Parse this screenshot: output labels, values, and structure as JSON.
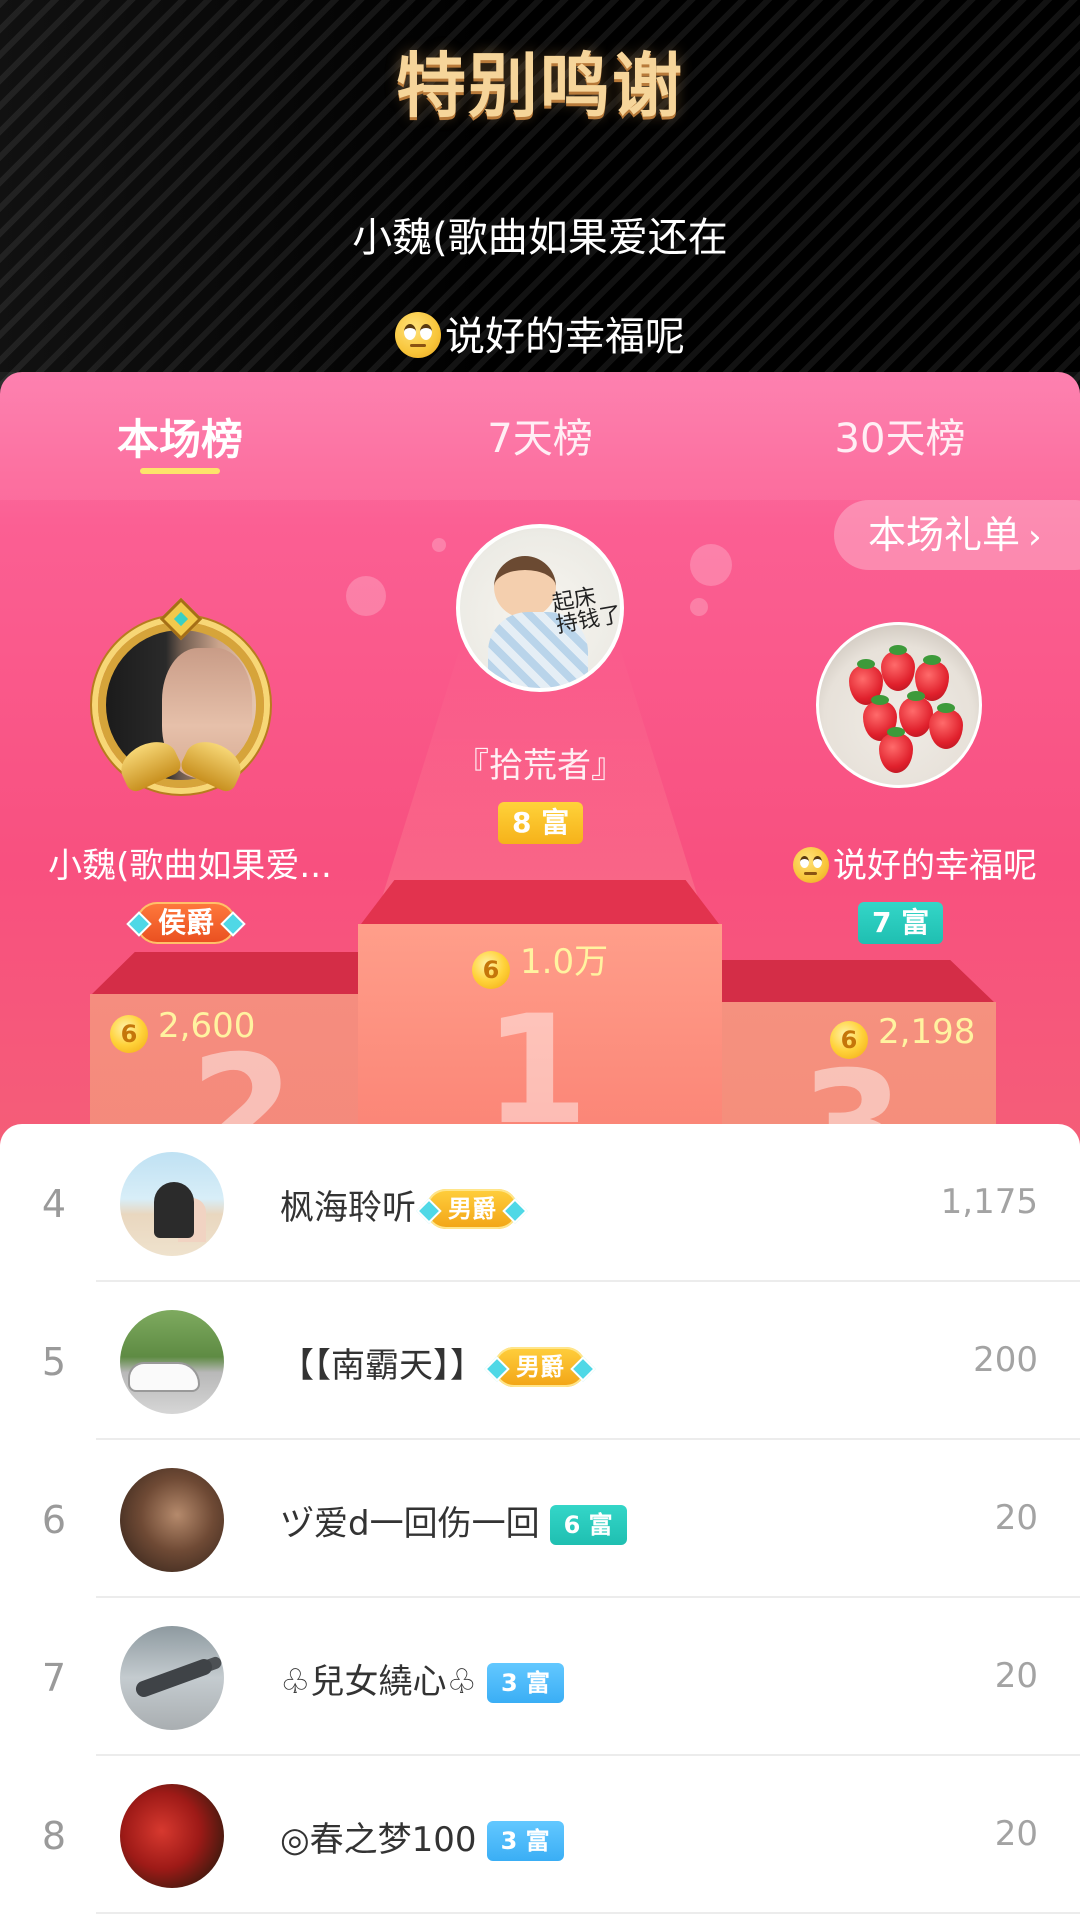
{
  "banner": {
    "title": "特别鸣谢",
    "lines": [
      "小魏(歌曲如果爱还在",
      "说好的幸福呢"
    ]
  },
  "tabs": [
    "本场榜",
    "7天榜",
    "30天榜"
  ],
  "active_tab": "本场榜",
  "gift_list_button": "本场礼单",
  "top3": [
    {
      "rank": 1,
      "name": "『拾荒者』",
      "badge": "8 富",
      "badge_color": "#f6b21a",
      "score": "1.0万",
      "avatar_text": "起床\n持钱了",
      "avatar_icon": "baby-avatar"
    },
    {
      "rank": 2,
      "name": "小魏(歌曲如果爱...",
      "badge": "侯爵",
      "badge_color": "#e94e1f",
      "score": "2,600",
      "avatar_icon": "woman-portrait-avatar"
    },
    {
      "rank": 3,
      "name": "说好的幸福呢",
      "badge": "7 富",
      "badge_color": "#1fbfb1",
      "score": "2,198",
      "avatar_icon": "strawberries-avatar"
    }
  ],
  "coin_glyph": "6",
  "list": [
    {
      "rank": "4",
      "name": "枫海聆听",
      "badge": "男爵",
      "badge_type": "noble",
      "score": "1,175",
      "avatar_icon": "couple-beach-avatar"
    },
    {
      "rank": "5",
      "name": "【【南霸天】】",
      "badge": "男爵",
      "badge_type": "noble",
      "score": "200",
      "avatar_icon": "car-avatar"
    },
    {
      "rank": "6",
      "name": "ヅ爱d一回伤一回",
      "badge": "6 富",
      "badge_type": "teal",
      "score": "20",
      "avatar_icon": "man-smoking-avatar"
    },
    {
      "rank": "7",
      "name": "♧兒女繞心♧",
      "badge": "3 富",
      "badge_type": "blue",
      "score": "20",
      "avatar_icon": "fighter-jet-avatar"
    },
    {
      "rank": "8",
      "name": "◎春之梦100",
      "badge": "3 富",
      "badge_type": "blue",
      "score": "20",
      "avatar_icon": "rose-avatar"
    }
  ]
}
